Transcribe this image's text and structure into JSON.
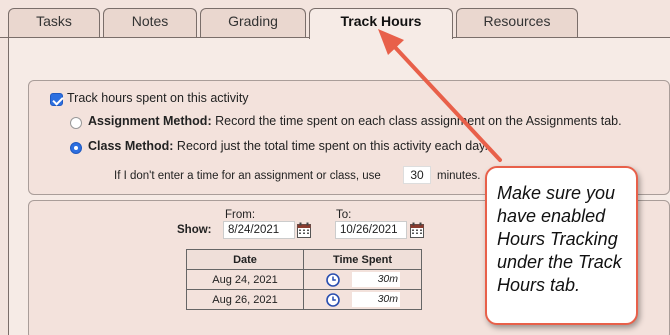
{
  "tabs": [
    {
      "label": "Tasks",
      "active": false
    },
    {
      "label": "Notes",
      "active": false
    },
    {
      "label": "Grading",
      "active": false
    },
    {
      "label": "Track Hours",
      "active": true
    },
    {
      "label": "Resources",
      "active": false
    }
  ],
  "settings": {
    "track_checkbox_label": "Track hours spent on this activity",
    "track_checked": true,
    "assignment_method": {
      "title": "Assignment Method:",
      "desc": "Record the time spent on each class assignment on the Assignments tab.",
      "selected": false
    },
    "class_method": {
      "title": "Class Method:",
      "desc": "Record just the total time spent on this activity each day.",
      "selected": true
    },
    "default_prefix": "If I don't enter a time for an assignment or class, use",
    "default_minutes": "30",
    "default_suffix": "minutes."
  },
  "log": {
    "show_label": "Show:",
    "from_label": "From:",
    "from_value": "8/24/2021",
    "to_label": "To:",
    "to_value": "10/26/2021",
    "columns": [
      "Date",
      "Time Spent"
    ],
    "rows": [
      {
        "date": "Aug 24, 2021",
        "spent": "30m"
      },
      {
        "date": "Aug 26, 2021",
        "spent": "30m"
      }
    ]
  },
  "callout": {
    "text": "Make sure you have enabled Hours Tracking under the Track Hours tab."
  },
  "colors": {
    "accent_blue": "#2d6fe0",
    "callout_border": "#e8604a",
    "background": "#f3e4de"
  }
}
